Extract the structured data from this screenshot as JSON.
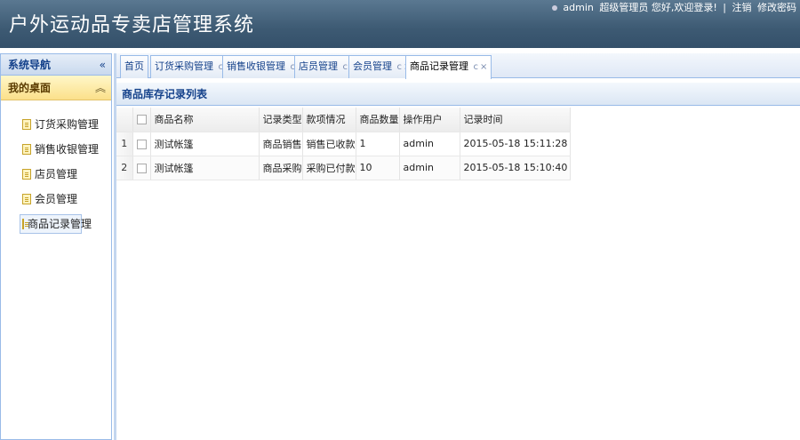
{
  "app": {
    "title": "户外运动品专卖店管理系统"
  },
  "user_bar": {
    "username": "admin",
    "greeting": "超级管理员 您好,欢迎登录!",
    "separator": "|",
    "logout": "注销",
    "change_password": "修改密码"
  },
  "sidebar": {
    "title": "系统导航",
    "collapse_icon": "«",
    "section": "我的桌面",
    "section_icon": "︽",
    "items": [
      {
        "label": "订货采购管理"
      },
      {
        "label": "销售收银管理"
      },
      {
        "label": "店员管理"
      },
      {
        "label": "会员管理"
      },
      {
        "label": "商品记录管理"
      }
    ]
  },
  "tabs": [
    {
      "label": "首页"
    },
    {
      "label": "订货采购管理"
    },
    {
      "label": "销售收银管理"
    },
    {
      "label": "店员管理"
    },
    {
      "label": "会员管理"
    },
    {
      "label": "商品记录管理"
    }
  ],
  "tab_controls": {
    "refresh": "c",
    "close": "×"
  },
  "panel": {
    "title": "商品库存记录列表"
  },
  "grid": {
    "columns": [
      "商品名称",
      "记录类型",
      "款项情况",
      "商品数量",
      "操作用户",
      "记录时间"
    ],
    "rows": [
      {
        "num": "1",
        "name": "测试帐篷",
        "type": "商品销售",
        "payment": "销售已收款",
        "qty": "1",
        "user": "admin",
        "time": "2015-05-18 15:11:28"
      },
      {
        "num": "2",
        "name": "测试帐篷",
        "type": "商品采购",
        "payment": "采购已付款",
        "qty": "10",
        "user": "admin",
        "time": "2015-05-18 15:10:40"
      }
    ]
  },
  "colors": {
    "header": "#3d5a73",
    "accent": "#99bbe8",
    "highlight": "#fbe08a"
  }
}
